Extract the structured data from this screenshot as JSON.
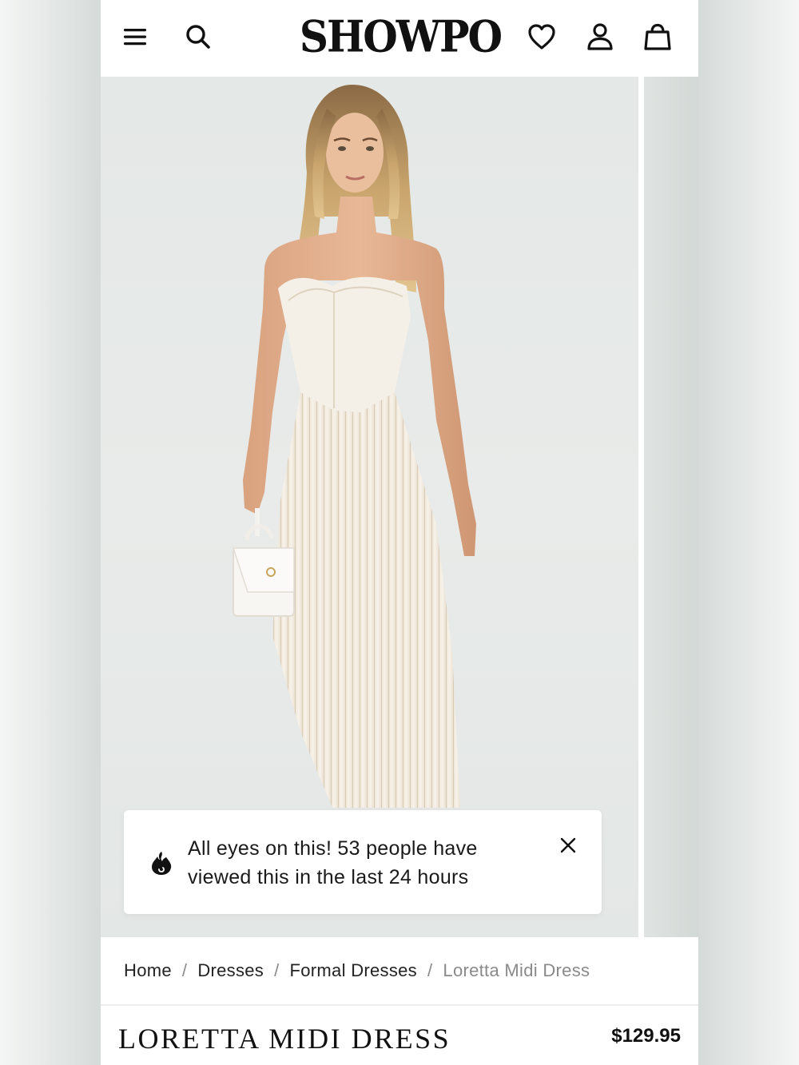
{
  "header": {
    "logo_text": "SHOWPO",
    "icons": [
      "menu-icon",
      "search-icon",
      "heart-icon",
      "account-icon",
      "bag-icon"
    ]
  },
  "gallery": {
    "main_image": "model-in-white-strapless-pleated-midi-dress-image",
    "next_image": "next-product-image-peek"
  },
  "toast": {
    "line1": "All eyes on this! 53 people have",
    "line2": "viewed this in the last 24 hours",
    "icon": "flame-icon",
    "close_icon": "close-icon"
  },
  "breadcrumb": {
    "items": [
      "Home",
      "Dresses",
      "Formal Dresses",
      "Loretta Midi Dress"
    ],
    "separator": "/"
  },
  "product": {
    "title": "LORETTA MIDI DRESS",
    "price": "$129.95"
  },
  "colors": {
    "text": "#111111",
    "muted": "#8a8a8a",
    "image_bg": "#e6e9e8",
    "dress": "#f4efe6"
  }
}
